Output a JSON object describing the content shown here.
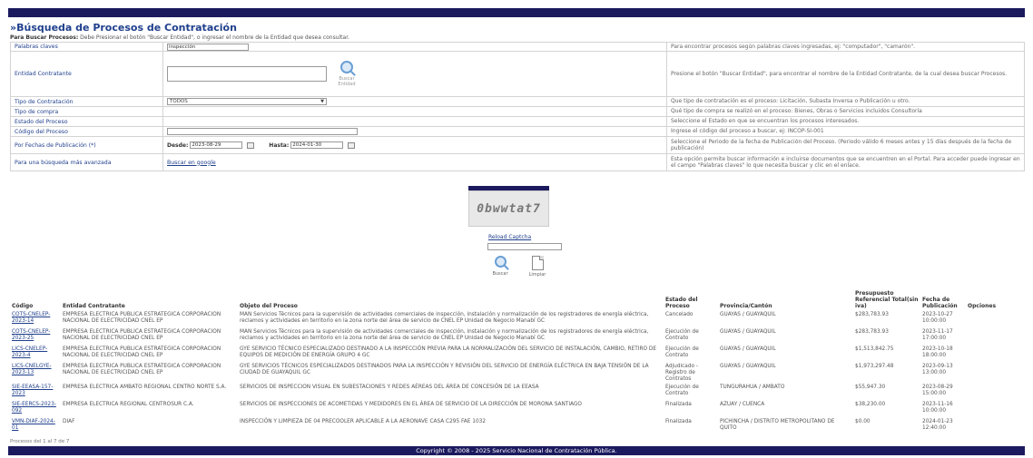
{
  "page": {
    "title": "»Búsqueda de Procesos de Contratación",
    "instructions_bold": "Para Buscar Procesos:",
    "instructions_text": "Debe Presionar el botón \"Buscar Entidad\", o ingresar el nombre de la Entidad que desea consultar."
  },
  "form": {
    "palabras_label": "Palabras claves",
    "palabras_value": "inspección",
    "palabras_hint": "Para encontrar procesos según palabras claves ingresadas, ej: \"computador\", \"camarón\".",
    "entidad_label": "Entidad Contratante",
    "buscar_entidad_label": "Buscar Entidad",
    "entidad_hint": "Presione el botón \"Buscar Entidad\", para encontrar el nombre de la Entidad Contratante, de la cual desea buscar Procesos.",
    "tipo_contratacion_label": "Tipo de Contratación",
    "tipo_contratacion_value": "TODOS",
    "tipo_contratacion_hint": "Que tipo de contratación es el proceso: Licitación, Subasta Inversa o Publicación u otro.",
    "tipo_compra_label": "Tipo de compra",
    "tipo_compra_hint": "Qué tipo de compra se realizó en el proceso: Bienes, Obras o Servicios incluidos Consultoría",
    "estado_label": "Estado del Proceso",
    "estado_hint": "Seleccione el Estado en que se encuentran los procesos interesados.",
    "codigo_label": "Código del Proceso",
    "codigo_hint": "Ingrese el código del proceso a buscar, ej: INCOP-SI-001",
    "fechas_label": "Por Fechas de Publicación (*)",
    "desde_label": "Desde:",
    "desde_value": "2023-08-29",
    "hasta_label": "Hasta:",
    "hasta_value": "2024-01-30",
    "fechas_hint": "Seleccione el Periodo de la fecha de Publicación del Proceso. (Periodo válido 6 meses antes y 15 días después de la fecha de publicación)",
    "avanzada_label": "Para una búsqueda más avanzada",
    "avanzada_link": "Buscar en google",
    "avanzada_hint": "Esta opción permite buscar información e incluirse documentos que se encuentren en el Portal. Para acceder puede ingresar en el campo \"Palabras claves\" lo que necesita buscar y clic en el enlace."
  },
  "captcha": {
    "text": "0bwwtat7",
    "reload_label": "Reload Captcha",
    "buscar_label": "Buscar",
    "limpiar_label": "Limpiar"
  },
  "results": {
    "headers": [
      "Código",
      "Entidad Contratante",
      "Objeto del Proceso",
      "Estado del Proceso",
      "Provincia/Cantón",
      "Presupuesto Referencial Total(sin iva)",
      "Fecha de Publicación",
      "Opciones"
    ],
    "rows": [
      {
        "code": "COTS-CNELEP-2023-14",
        "entity": "EMPRESA ELECTRICA PUBLICA ESTRATEGICA CORPORACION NACIONAL DE ELECTRICIDAD CNEL EP",
        "object": "MAN Servicios Técnicos para la supervisión de actividades comerciales de inspección, instalación y normalización de los registradores de energía eléctrica, reclamos y actividades en territorio en la zona norte del área de servicio de CNEL EP Unidad de Negocio Manabí GC",
        "status": "Cancelado",
        "location": "GUAYAS / GUAYAQUIL",
        "budget": "$283,783.93",
        "date": "2023-10-27 10:00:00"
      },
      {
        "code": "COTS-CNELEP-2023-25",
        "entity": "EMPRESA ELECTRICA PUBLICA ESTRATEGICA CORPORACION NACIONAL DE ELECTRICIDAD CNEL EP",
        "object": "MAN Servicios Técnicos para la supervisión de actividades comerciales de inspección, instalación y normalización de los registradores de energía eléctrica, reclamos y actividades en territorio en la zona norte del área de servicio de CNEL EP Unidad de Negocio Manabí GC",
        "status": "Ejecución de Contrato",
        "location": "GUAYAS / GUAYAQUIL",
        "budget": "$283,783.93",
        "date": "2023-11-17 17:00:00"
      },
      {
        "code": "LICS-CNELEP-2023-4",
        "entity": "EMPRESA ELECTRICA PUBLICA ESTRATEGICA CORPORACION NACIONAL DE ELECTRICIDAD CNEL EP",
        "object": "GYE SERVICIO TÉCNICO ESPECIALIZADO DESTINADO A LA INSPECCIÓN PREVIA PARA LA NORMALIZACIÓN DEL SERVICIO DE INSTALACIÓN, CAMBIO, RETIRO DE EQUIPOS DE MEDICIÓN DE ENERGÍA GRUPO 4 GC",
        "status": "Ejecución de Contrato",
        "location": "GUAYAS / GUAYAQUIL",
        "budget": "$1,513,842.75",
        "date": "2023-10-18 18:00:00"
      },
      {
        "code": "LICS-CNELGYE-2023-13",
        "entity": "EMPRESA ELECTRICA PUBLICA ESTRATEGICA CORPORACION NACIONAL DE ELECTRICIDAD CNEL EP",
        "object": "GYE SERVICIOS TÉCNICOS ESPECIALIZADOS DESTINADOS PARA LA INSPECCIÓN Y REVISIÓN DEL SERVICIO DE ENERGÍA ELÉCTRICA EN BAJA TENSIÓN DE LA CIUDAD DE GUAYAQUIL GC",
        "status": "Adjudicado - Registro de Contratos",
        "location": "GUAYAS / GUAYAQUIL",
        "budget": "$1,973,297.48",
        "date": "2023-09-13 13:00:00"
      },
      {
        "code": "SIE-EEASA-157-2023",
        "entity": "EMPRESA ELECTRICA AMBATO REGIONAL CENTRO NORTE S.A.",
        "object": "SERVICIOS DE INSPECCION VISUAL EN SUBESTACIONES Y REDES AÉREAS DEL ÁREA DE CONCESIÓN DE LA EEASA",
        "status": "Ejecución de Contrato",
        "location": "TUNGURAHUA / AMBATO",
        "budget": "$55,947.30",
        "date": "2023-08-29 15:00:00"
      },
      {
        "code": "SIE-EERCS-2023-092",
        "entity": "EMPRESA ELECTRICA REGIONAL CENTROSUR C.A.",
        "object": "SERVICIOS DE INSPECCIONES DE ACOMETIDAS Y MEDIDORES EN EL ÁREA DE SERVICIO DE LA DIRECCIÓN DE MORONA SANTIAGO",
        "status": "Finalizada",
        "location": "AZUAY / CUENCA",
        "budget": "$38,230.00",
        "date": "2023-11-16 10:00:00"
      },
      {
        "code": "VMN-DIAF-2024-01",
        "entity": "DIAF",
        "object": "INSPECCIÓN Y LIMPIEZA DE 04 PRECOOLER APLICABLE A LA AERONAVE CASA C295 FAE 1032",
        "status": "Finalizada",
        "location": "PICHINCHA / DISTRITO METROPOLITANO DE QUITO",
        "budget": "$0.00",
        "date": "2024-01-23 12:40:00"
      }
    ],
    "footer": "Procesos del 1 al 7 de 7"
  },
  "copyright": "Copyright © 2008 - 2025 Servicio Nacional de Contratación Pública."
}
